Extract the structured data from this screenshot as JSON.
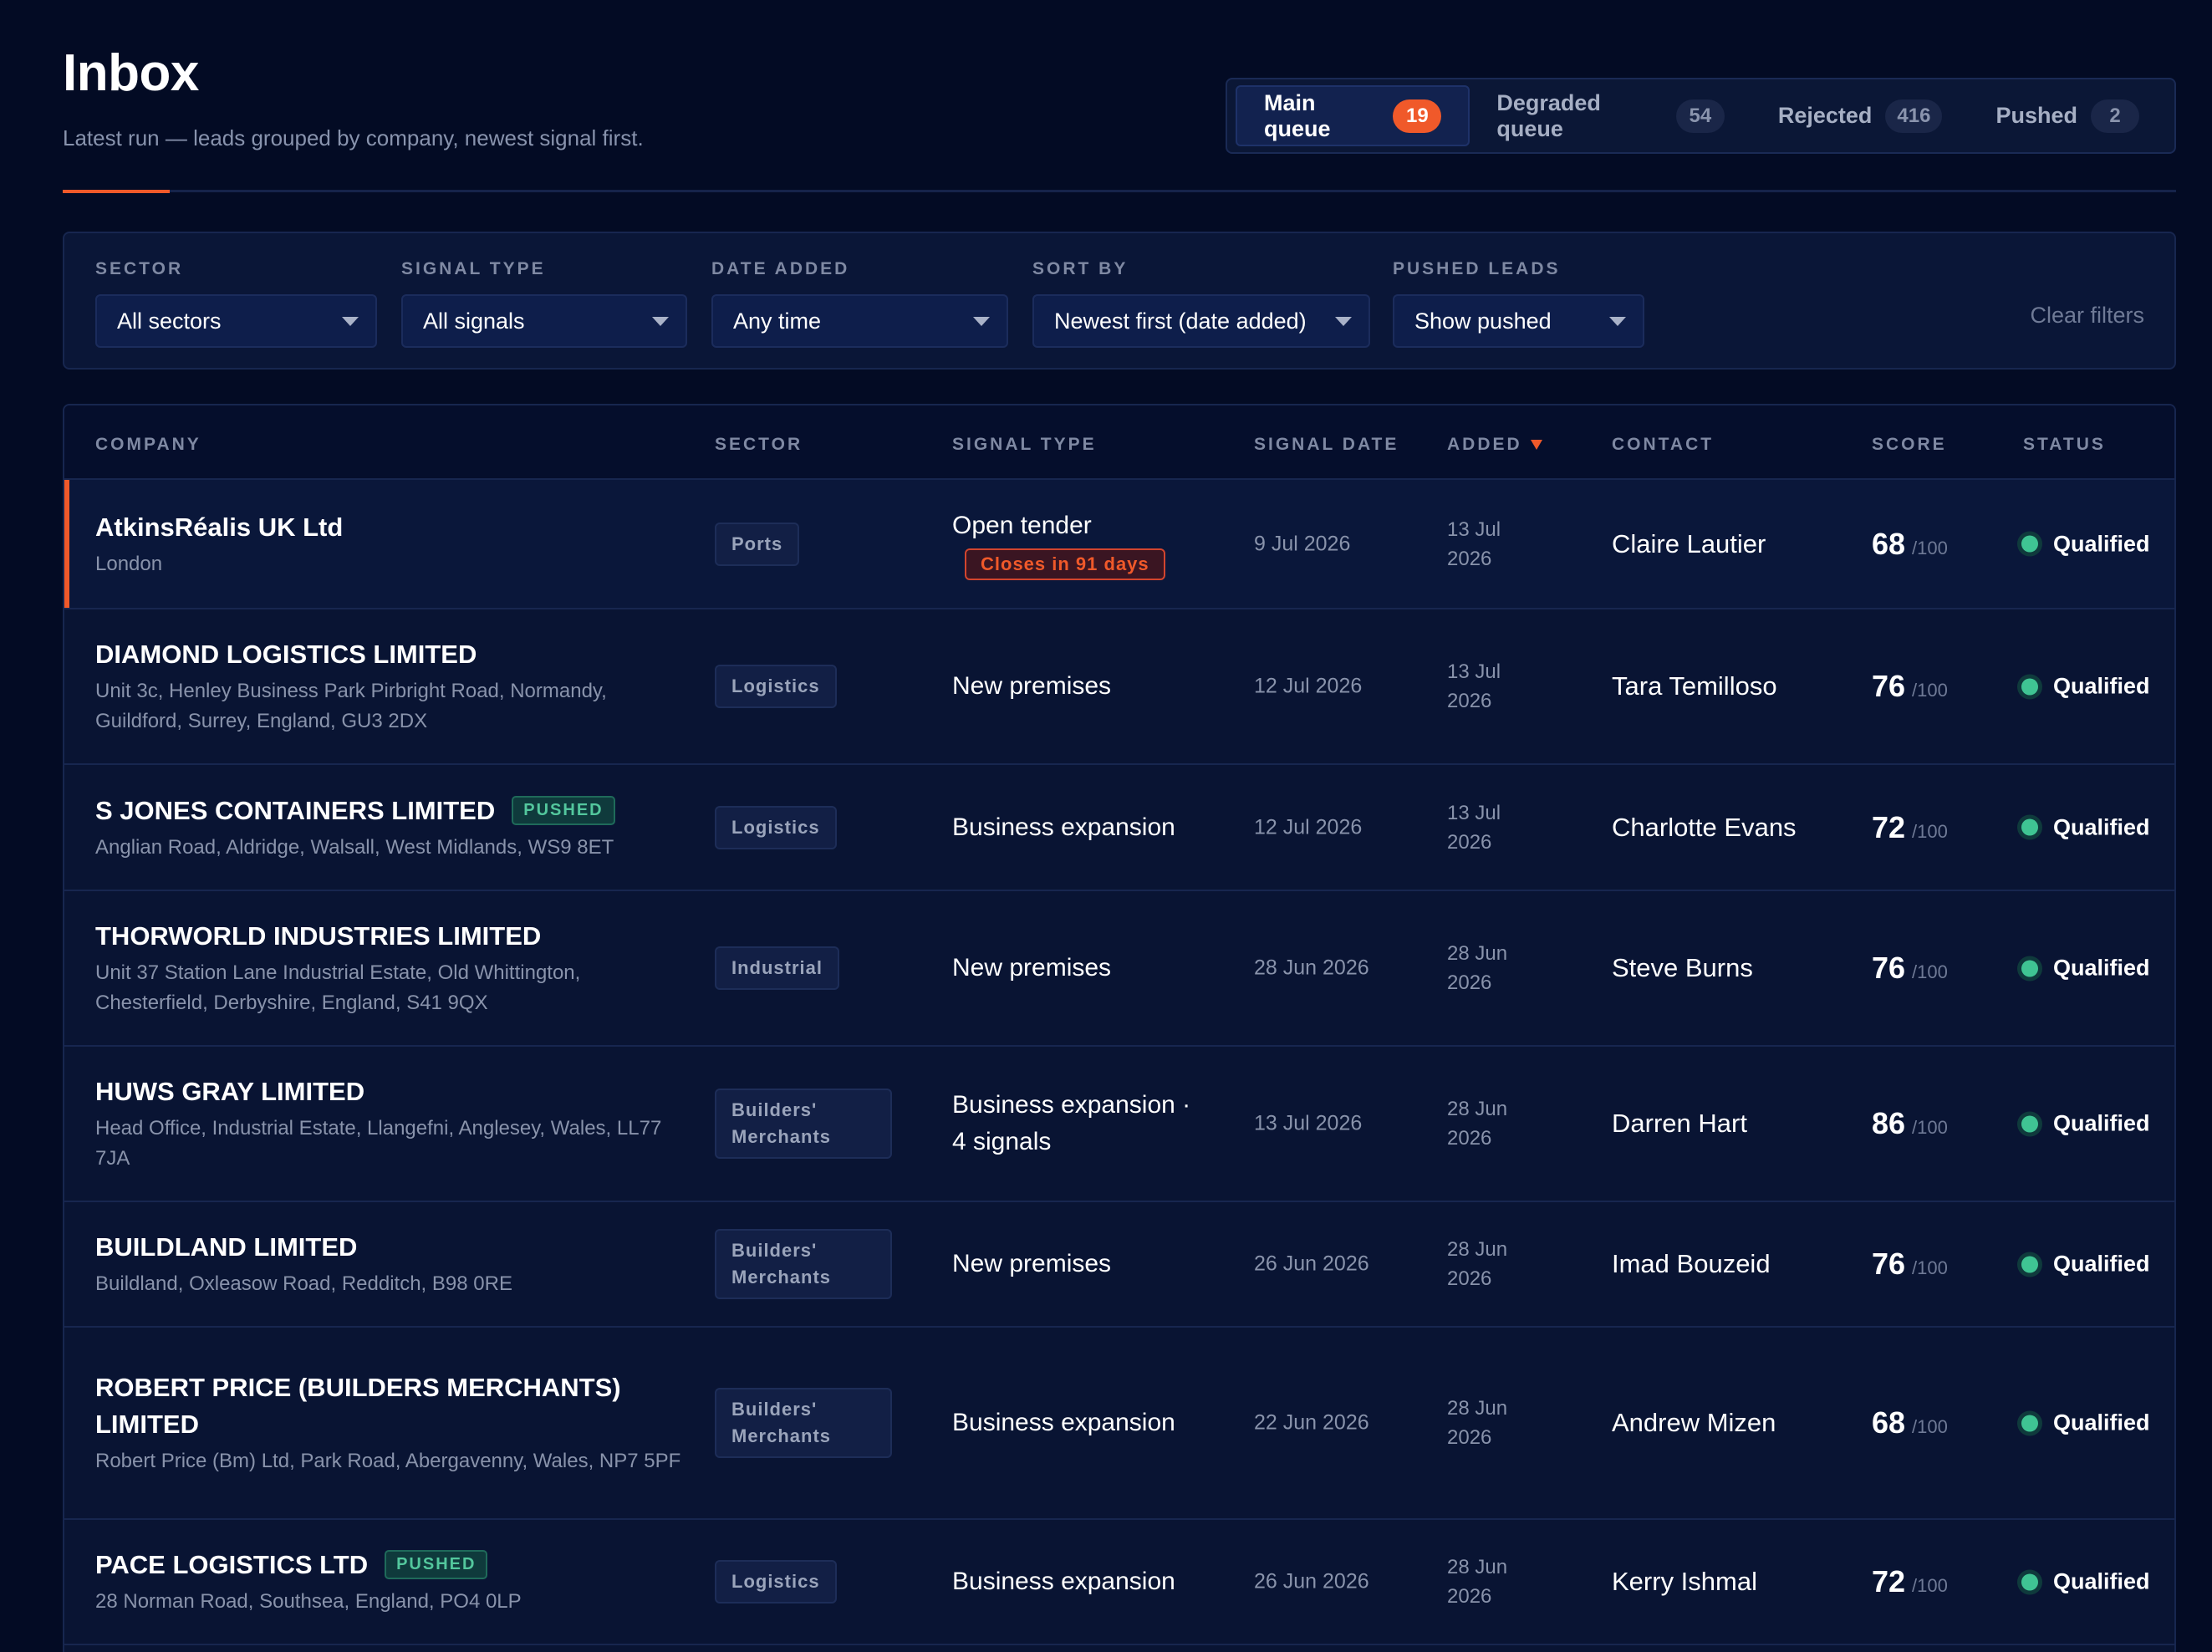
{
  "header": {
    "title": "Inbox",
    "subtitle": "Latest run — leads grouped by company, newest signal first."
  },
  "tabs": [
    {
      "label": "Main queue",
      "count": "19",
      "active": true
    },
    {
      "label": "Degraded queue",
      "count": "54",
      "active": false
    },
    {
      "label": "Rejected",
      "count": "416",
      "active": false
    },
    {
      "label": "Pushed",
      "count": "2",
      "active": false
    }
  ],
  "filters": {
    "sector": {
      "label": "SECTOR",
      "value": "All sectors"
    },
    "signal_type": {
      "label": "SIGNAL TYPE",
      "value": "All signals"
    },
    "date_added": {
      "label": "DATE ADDED",
      "value": "Any time"
    },
    "sort_by": {
      "label": "SORT BY",
      "value": "Newest first (date added)"
    },
    "pushed_leads": {
      "label": "PUSHED LEADS",
      "value": "Show pushed"
    },
    "clear_label": "Clear filters"
  },
  "columns": {
    "company": "COMPANY",
    "sector": "SECTOR",
    "signal_type": "SIGNAL TYPE",
    "signal_date": "SIGNAL DATE",
    "added": "ADDED",
    "contact": "CONTACT",
    "score": "SCORE",
    "status": "STATUS"
  },
  "score_suffix": "/100",
  "pushed_label": "PUSHED",
  "rows": [
    {
      "company": "AtkinsRéalis UK Ltd",
      "address": "London",
      "pushed": false,
      "sector": "Ports",
      "signal": "Open tender",
      "signal_note": "Closes in 91 days",
      "signal_date": "9 Jul 2026",
      "added": "13 Jul 2026",
      "contact": "Claire Lautier",
      "score": "68",
      "status": "Qualified",
      "highlight": true
    },
    {
      "company": "DIAMOND LOGISTICS LIMITED",
      "address": "Unit 3c, Henley Business Park Pirbright Road, Normandy, Guildford, Surrey, England, GU3 2DX",
      "pushed": false,
      "sector": "Logistics",
      "signal": "New premises",
      "signal_note": "",
      "signal_date": "12 Jul 2026",
      "added": "13 Jul 2026",
      "contact": "Tara Temilloso",
      "score": "76",
      "status": "Qualified",
      "highlight": false
    },
    {
      "company": "S JONES CONTAINERS LIMITED",
      "address": "Anglian Road, Aldridge, Walsall, West Midlands, WS9 8ET",
      "pushed": true,
      "sector": "Logistics",
      "signal": "Business expansion",
      "signal_note": "",
      "signal_date": "12 Jul 2026",
      "added": "13 Jul 2026",
      "contact": "Charlotte Evans",
      "score": "72",
      "status": "Qualified",
      "highlight": false
    },
    {
      "company": "THORWORLD INDUSTRIES LIMITED",
      "address": "Unit 37 Station Lane Industrial Estate, Old Whittington, Chesterfield, Derbyshire, England, S41 9QX",
      "pushed": false,
      "sector": "Industrial",
      "signal": "New premises",
      "signal_note": "",
      "signal_date": "28 Jun 2026",
      "added": "28 Jun 2026",
      "contact": "Steve Burns",
      "score": "76",
      "status": "Qualified",
      "highlight": false
    },
    {
      "company": "HUWS GRAY LIMITED",
      "address": "Head Office, Industrial Estate, Llangefni, Anglesey, Wales, LL77 7JA",
      "pushed": false,
      "sector": "Builders' Merchants",
      "signal": "Business expansion · 4 signals",
      "signal_note": "",
      "signal_date": "13 Jul 2026",
      "added": "28 Jun 2026",
      "contact": "Darren Hart",
      "score": "86",
      "status": "Qualified",
      "highlight": false
    },
    {
      "company": "BUILDLAND LIMITED",
      "address": "Buildland, Oxleasow Road, Redditch, B98 0RE",
      "pushed": false,
      "sector": "Builders' Merchants",
      "signal": "New premises",
      "signal_note": "",
      "signal_date": "26 Jun 2026",
      "added": "28 Jun 2026",
      "contact": "Imad Bouzeid",
      "score": "76",
      "status": "Qualified",
      "highlight": false
    },
    {
      "company": "ROBERT PRICE (BUILDERS MERCHANTS) LIMITED",
      "address": "Robert Price (Bm) Ltd, Park Road, Abergavenny, Wales, NP7 5PF",
      "pushed": false,
      "sector": "Builders' Merchants",
      "signal": "Business expansion",
      "signal_note": "",
      "signal_date": "22 Jun 2026",
      "added": "28 Jun 2026",
      "contact": "Andrew Mizen",
      "score": "68",
      "status": "Qualified",
      "highlight": false
    },
    {
      "company": "PACE LOGISTICS LTD",
      "address": "28 Norman Road, Southsea, England, PO4 0LP",
      "pushed": true,
      "sector": "Logistics",
      "signal": "Business expansion",
      "signal_note": "",
      "signal_date": "26 Jun 2026",
      "added": "28 Jun 2026",
      "contact": "Kerry Ishmal",
      "score": "72",
      "status": "Qualified",
      "highlight": false
    }
  ]
}
